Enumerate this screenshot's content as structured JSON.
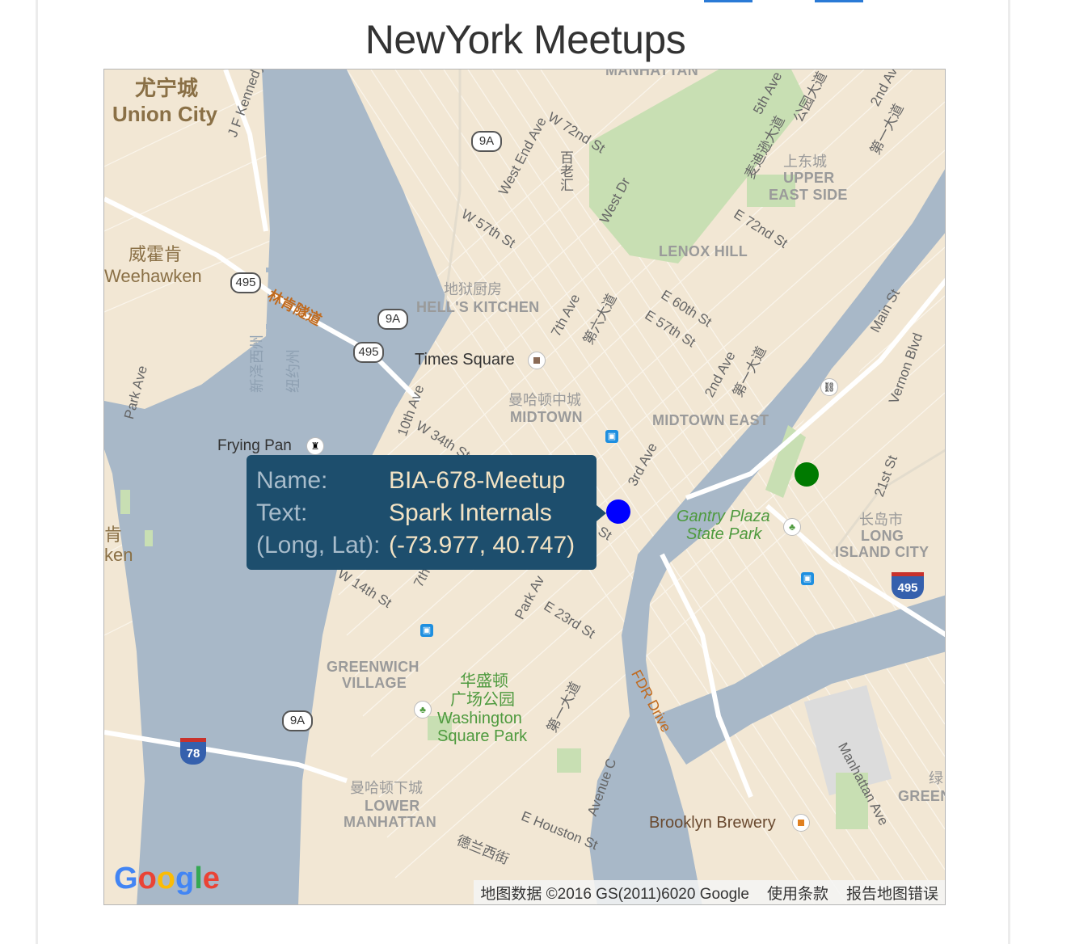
{
  "page": {
    "title": "NewYork Meetups"
  },
  "tooltip": {
    "rows": [
      {
        "key": "Name:",
        "value": "BIA-678-Meetup"
      },
      {
        "key": "Text:",
        "value": "Spark Internals"
      },
      {
        "key": "(Long, Lat):",
        "value": "(-73.977, 40.747)"
      }
    ]
  },
  "markers": [
    {
      "name": "BIA-678-Meetup",
      "longitude": -73.977,
      "latitude": 40.747,
      "color": "#0000ff"
    },
    {
      "name": "",
      "color": "#007a00"
    }
  ],
  "map": {
    "colors": {
      "land": "#f2e7d4",
      "water": "#a8b8c8",
      "park": "#c8dfb3",
      "highway": "#ffffff",
      "tooltip_bg": "#1d4e6d"
    },
    "labels": {
      "union_city_cn": "尤宁城",
      "union_city": "Union City",
      "weehawken_cn": "威霍肯",
      "weehawken": "Weehawken",
      "hoboken_cn": "肯",
      "hoboken_fragment": "ken",
      "jfk_blvd": "J F Kennedy Blvd E",
      "park_ave_west": "Park Ave",
      "lincoln_tunnel": "林肯隧道",
      "nj_cn": "新泽西州",
      "ny_cn": "纽约州",
      "manhattan_top": "MANHATTAN",
      "w72": "W 72nd St",
      "west_end": "West End Ave",
      "broadway_cn": "百老汇",
      "west_dr": "West Dr",
      "w57": "W 57th St",
      "hells_kitchen_cn": "地狱厨房",
      "hells_kitchen": "HELL'S KITCHEN",
      "times_square": "Times Square",
      "seventh_ave": "7th Ave",
      "sixth_ave_cn": "第六大道",
      "lenox_hill": "LENOX HILL",
      "upper_east_cn": "上东城",
      "upper_east_1": "UPPER",
      "upper_east_2": "EAST SIDE",
      "fifth_ave_a": "5th Ave",
      "fifth_ave_cn": "麦迪逊大道",
      "park_ave_cn": "公园大道",
      "e72": "E 72nd St",
      "second_ave_top": "2nd Av",
      "first_ave_cn_top": "第一大道",
      "e60": "E 60th St",
      "e57": "E 57th St",
      "second_ave": "2nd Ave",
      "first_ave_cn": "第一大道",
      "main_st": "Main St",
      "vernon": "Vernon Blvd",
      "midtown_cn": "曼哈顿中城",
      "midtown": "MIDTOWN",
      "midtown_east": "MIDTOWN EAST",
      "tenth_ave": "10th Ave",
      "w34": "W 34th St",
      "frying_pan": "Frying Pan",
      "third_ave": "3rd Ave",
      "n_st": "h St",
      "gantry_1": "Gantry Plaza",
      "gantry_2": "State Park",
      "lic_cn": "长岛市",
      "lic_1": "LONG",
      "lic_2": "ISLAND CITY",
      "twentyfirst": "21st St",
      "w14": "W 14th St",
      "seventh_frag": "7th",
      "park_ave_s": "Park Av",
      "e23": "E 23rd St",
      "fdr": "FDR Drive",
      "greenwich_1": "GREENWICH",
      "greenwich_2": "VILLAGE",
      "wsp_cn_1": "华盛顿",
      "wsp_cn_2": "广场公园",
      "wsp_1": "Washington",
      "wsp_2": "Square Park",
      "first_ave_cn_low": "第一大道",
      "avenue_c": "Avenue C",
      "lower_cn": "曼哈顿下城",
      "lower_1": "LOWER",
      "lower_2": "MANHATTAN",
      "e_houston": "E Houston St",
      "delancey_cn": "德兰西街",
      "brooklyn_brewery": "Brooklyn Brewery",
      "manhattan_ave": "Manhattan Ave",
      "greenpoint_cn": "绿",
      "greenpoint": "GREEN"
    },
    "shields": {
      "r9a_1": "9A",
      "r9a_2": "9A",
      "r9a_3": "9A",
      "r495_1": "495",
      "r495_2": "495",
      "i495": "495",
      "i78": "78"
    },
    "attribution": {
      "data": "地图数据 ©2016 GS(2011)6020 Google",
      "terms": "使用条款",
      "report": "报告地图错误"
    },
    "logo": {
      "g1": "G",
      "o1": "o",
      "o2": "o",
      "g2": "g",
      "l": "l",
      "e": "e"
    }
  }
}
